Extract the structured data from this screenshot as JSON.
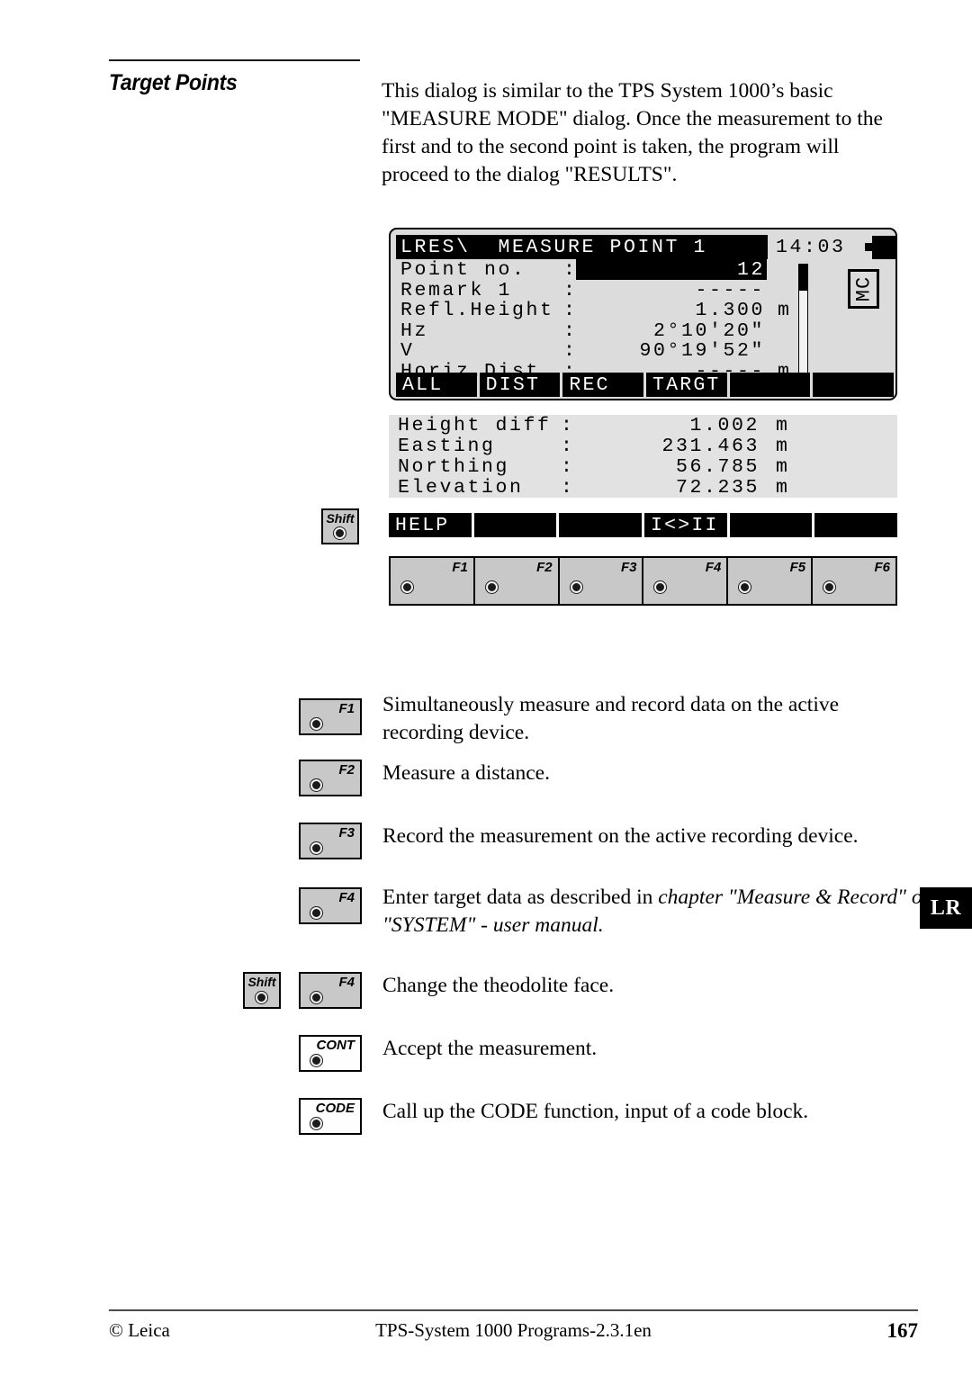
{
  "heading": {
    "title": "Target Points"
  },
  "intro": {
    "paragraph": "This dialog is similar to the TPS System 1000’s basic \"MEASURE MODE\" dialog. Once the measurement to the first and to the second point is taken, the program will proceed to the dialog \"RESULTS\"."
  },
  "lcd": {
    "title_bar": "LRES\\  MEASURE POINT 1",
    "time": "14:03",
    "status_indicator": "MC",
    "rows": [
      {
        "label": "Point no.",
        "colon": ":",
        "value": "12",
        "unit": "",
        "highlighted": true
      },
      {
        "label": "Remark 1",
        "colon": ":",
        "value": "-----",
        "unit": "",
        "highlighted": false
      },
      {
        "label": "Refl.Height",
        "colon": ":",
        "value": "1.300",
        "unit": "m",
        "highlighted": false
      },
      {
        "label": "Hz",
        "colon": ":",
        "value": "2°10'20\"",
        "unit": "",
        "highlighted": false
      },
      {
        "label": "V",
        "colon": ":",
        "value": "90°19'52\"",
        "unit": "",
        "highlighted": false
      },
      {
        "label": "Horiz.Dist.",
        "colon": ":",
        "value": "-----",
        "unit": "m",
        "highlighted": false
      }
    ],
    "softkeys": [
      "ALL",
      "DIST",
      "REC",
      "TARGT",
      "",
      ""
    ]
  },
  "results": {
    "rows": [
      {
        "label": "Height diff",
        "colon": ":",
        "value": "1.002",
        "unit": "m"
      },
      {
        "label": "Easting",
        "colon": ":",
        "value": "231.463",
        "unit": "m"
      },
      {
        "label": "Northing",
        "colon": ":",
        "value": "56.785",
        "unit": "m"
      },
      {
        "label": "Elevation",
        "colon": ":",
        "value": "72.235",
        "unit": "m"
      }
    ]
  },
  "shift_softkeys": {
    "shift_key_label": "Shift",
    "keys": [
      "HELP",
      "",
      "",
      "I<>II",
      "",
      ""
    ]
  },
  "fkey_strip": {
    "keys": [
      "F1",
      "F2",
      "F3",
      "F4",
      "F5",
      "F6"
    ]
  },
  "legend": [
    {
      "keys": [
        "F1"
      ],
      "text": "Simultaneously measure and record data on the active recording device."
    },
    {
      "keys": [
        "F2"
      ],
      "text": "Measure a distance."
    },
    {
      "keys": [
        "F3"
      ],
      "text": "Record the measurement on the active recording device."
    },
    {
      "keys": [
        "F4"
      ],
      "text_plain": "Enter target data as described in ",
      "text_italic": "chapter \"Measure & Record\" of \"SYSTEM\" - user manual."
    },
    {
      "keys": [
        "Shift",
        "F4"
      ],
      "text": "Change the theodolite face."
    },
    {
      "keys": [
        "CONT"
      ],
      "text": "Accept the measurement."
    },
    {
      "keys": [
        "CODE"
      ],
      "text": "Call up the CODE function, input of a code block."
    }
  ],
  "side_tab": {
    "label": "LR"
  },
  "footer": {
    "copyright": "© Leica",
    "center": "TPS-System 1000 Programs-2.3.1en",
    "page_number": "167"
  },
  "colors": {
    "page_background": "#ffffff",
    "lcd_background": "#dcdcdc",
    "results_background": "#e2e2e2",
    "inverted_background": "#000000",
    "inverted_text": "#ffffff",
    "key_face": "#c8c8c8",
    "key_face_white": "#fefefe",
    "text": "#000000"
  }
}
